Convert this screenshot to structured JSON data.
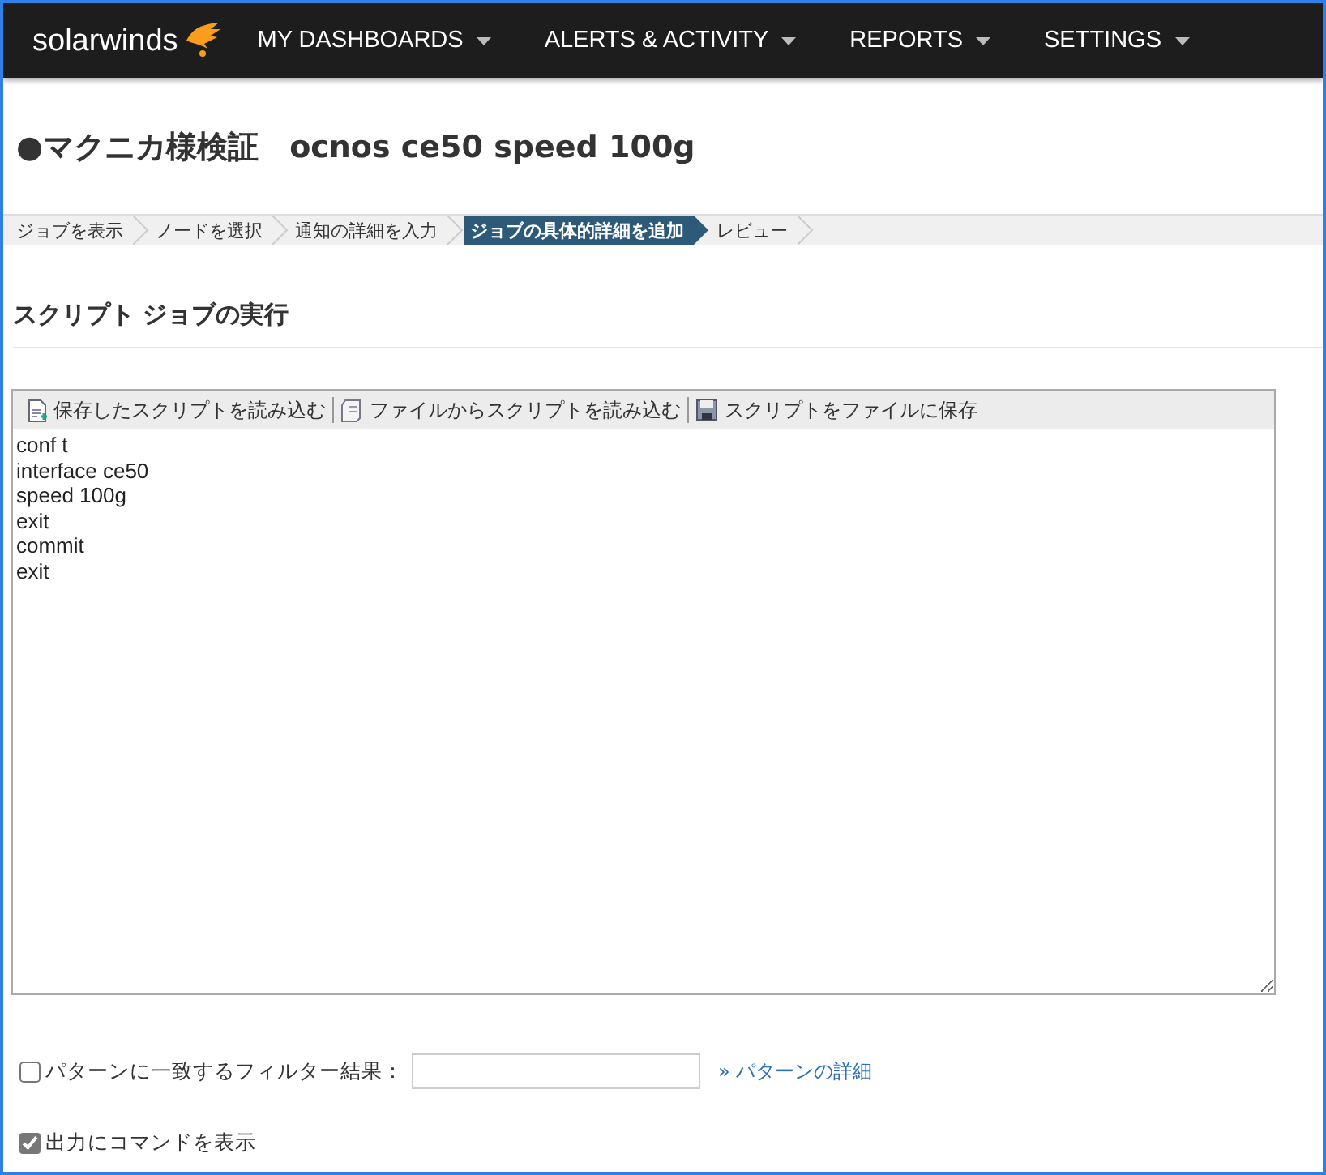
{
  "brand": {
    "name": "solarwinds"
  },
  "nav": [
    {
      "label": "MY DASHBOARDS"
    },
    {
      "label": "ALERTS & ACTIVITY"
    },
    {
      "label": "REPORTS"
    },
    {
      "label": "SETTINGS"
    }
  ],
  "title": "●マクニカ様検証　ocnos ce50 speed 100g",
  "steps": [
    {
      "label": "ジョブを表示",
      "selected": false
    },
    {
      "label": "ノードを選択",
      "selected": false
    },
    {
      "label": "通知の詳細を入力",
      "selected": false
    },
    {
      "label": "ジョブの具体的詳細を追加",
      "selected": true
    },
    {
      "label": "レビュー",
      "selected": false
    }
  ],
  "section_title": "スクリプト ジョブの実行",
  "toolbar": [
    {
      "kind": "load",
      "label": "保存したスクリプトを読み込む"
    },
    {
      "kind": "file",
      "label": "ファイルからスクリプトを読み込む"
    },
    {
      "kind": "save",
      "label": "スクリプトをファイルに保存"
    }
  ],
  "script": "conf t\ninterface ce50\nspeed 100g\nexit\ncommit\nexit",
  "filter": {
    "label": "パターンに一致するフィルター結果：",
    "checked": false,
    "link": "» パターンの詳細"
  },
  "show_commands": {
    "label": "出力にコマンドを表示",
    "checked": true
  }
}
